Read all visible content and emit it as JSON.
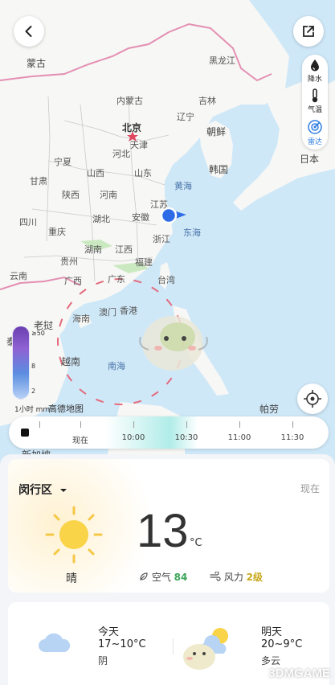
{
  "toolbar": {
    "back_icon": "chevron-left-icon",
    "share_icon": "share-external-icon"
  },
  "layers": [
    {
      "label": "降水",
      "icon": "droplet-icon",
      "active": false
    },
    {
      "label": "气温",
      "icon": "thermometer-icon",
      "active": false
    },
    {
      "label": "雷达",
      "icon": "radar-icon",
      "active": true
    }
  ],
  "map": {
    "labels": {
      "mongolia": "蒙古",
      "heilongjiang": "黑龙江",
      "neimenggu": "内蒙古",
      "jilin": "吉林",
      "beijing": "北京",
      "liaoning": "辽宁",
      "tianjin": "天津",
      "chaoxian": "朝鲜",
      "hebei": "河北",
      "ningxia": "宁夏",
      "shanxi": "山西",
      "shandong": "山东",
      "hanguo": "韩国",
      "riben": "日本",
      "gansu": "甘肃",
      "shaanxi": "陕西",
      "henan": "河南",
      "jiangsu": "江苏",
      "huanghai": "黄海",
      "sichuan": "四川",
      "hubei": "湖北",
      "anhui": "安徽",
      "chongqing": "重庆",
      "zhejiang": "浙江",
      "donghai": "东海",
      "guizhou": "贵州",
      "hunan": "湖南",
      "jiangxi": "江西",
      "fujian": "福建",
      "yunnan": "云南",
      "guangxi": "广西",
      "guangdong": "广东",
      "taiwan": "台湾",
      "aomen": "澳门",
      "xianggang": "香港",
      "hainan": "海南",
      "laowo": "老挝",
      "tai": "泰",
      "yuenan": "越南",
      "nanhai": "南海",
      "palau": "帕劳",
      "xinjiapo": "新加坡",
      "amap": "高德地图"
    }
  },
  "legend": {
    "ticks": [
      "≥50",
      "8",
      "2"
    ],
    "caption": "1小时 mm"
  },
  "timeline": {
    "labels": [
      "现在",
      "10:00",
      "10:30",
      "11:00",
      "11:30"
    ],
    "play_icon": "stop-square-icon"
  },
  "current": {
    "district": "闵行区",
    "dropdown_icon": "caret-down-icon",
    "now_label": "现在",
    "temperature": "13",
    "unit": "°C",
    "condition": "晴",
    "condition_icon": "sun-icon",
    "air_label": "空气",
    "air_value": "84",
    "wind_label": "风力",
    "wind_value": "2级"
  },
  "forecast": {
    "today": {
      "title": "今天",
      "range": "17~10°C",
      "condition": "阴",
      "icon": "cloud-icon"
    },
    "tomorrow": {
      "title": "明天",
      "range": "20~9°C",
      "condition": "多云",
      "icon": "partly-cloudy-icon"
    }
  },
  "watermark": "3DMGAME",
  "colors": {
    "accent": "#2e7de1",
    "air_good": "#3aa55a",
    "wind": "#c8a81c",
    "location_dot": "#2e6be6"
  }
}
